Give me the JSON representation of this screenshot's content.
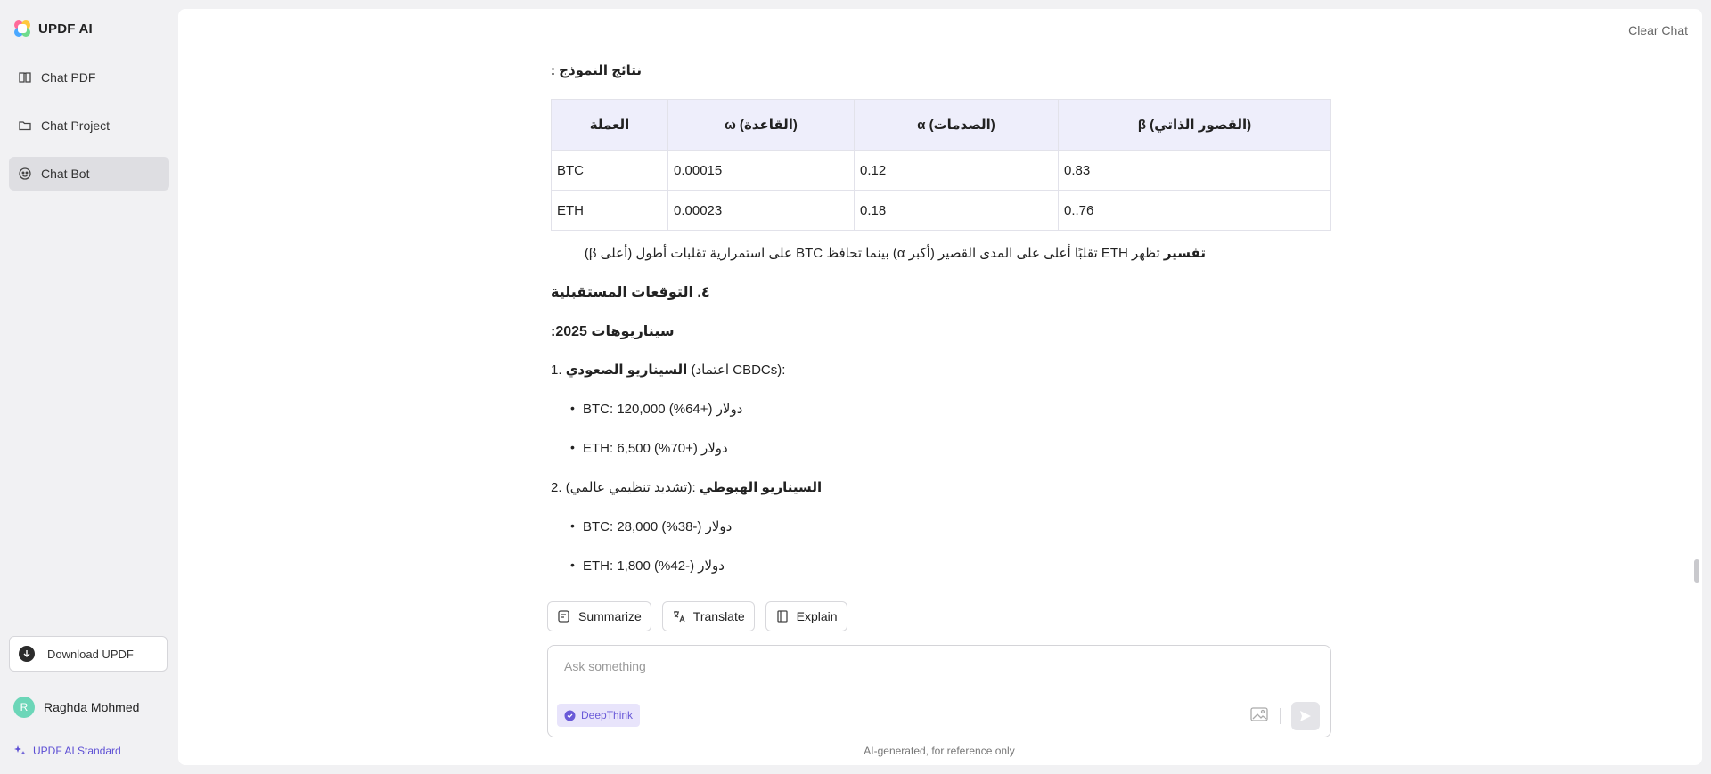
{
  "app": {
    "name": "UPDF AI"
  },
  "sidebar": {
    "items": [
      {
        "label": "Chat PDF",
        "icon": "book-icon"
      },
      {
        "label": "Chat Project",
        "icon": "folder-icon"
      },
      {
        "label": "Chat Bot",
        "icon": "bot-icon",
        "active": true
      }
    ],
    "download_label": "Download UPDF",
    "user_initial": "R",
    "user_name": "Raghda Mohmed",
    "plan_label": "UPDF AI Standard"
  },
  "header": {
    "clear_chat": "Clear Chat"
  },
  "message": {
    "results_title": "نتائج النموذج :",
    "table": {
      "headers": [
        "العملة",
        "ω (القاعدة)",
        "α (الصدمات)",
        "β (القصور الذاتي)"
      ],
      "rows": [
        [
          "BTC",
          "0.00015",
          "0.12",
          "0.83"
        ],
        [
          "ETH",
          "0.00023",
          "0.18",
          "0..76"
        ]
      ]
    },
    "interpretation_label": "تفسير",
    "interpretation_text": "تظهر ETH تقلبًا أعلى على المدى القصير (أكبر α) بينما تحافظ BTC على استمرارية تقلبات أطول (أعلى β)",
    "section4": "٤. التوقعات المستقبلية",
    "scenarios_title": "سيناريوهات 2025:",
    "scenario1_num": "1.",
    "scenario1_title": "السيناريو الصعودي",
    "scenario1_desc": "(اعتماد CBDCs):",
    "scenario1_btc": "BTC: 120,000 دولار (+64%)",
    "scenario1_eth": "ETH: 6,500 دولار (+70%)",
    "scenario2_num": "2.",
    "scenario2_title": "السيناريو الهبوطي",
    "scenario2_desc": "(تشديد تنظيمي عالمي):",
    "scenario2_btc": "BTC: 28,000 دولار (-38%)",
    "scenario2_eth": "ETH: 1,800 دولار (-42%)"
  },
  "actions": {
    "summarize": "Summarize",
    "translate": "Translate",
    "explain": "Explain"
  },
  "composer": {
    "placeholder": "Ask something",
    "deepthink": "DeepThink"
  },
  "disclaimer": "AI-generated, for reference only",
  "colors": {
    "accent": "#6a5ad8",
    "table_header_bg": "#eeeefb",
    "sidebar_active": "#dedee2"
  }
}
